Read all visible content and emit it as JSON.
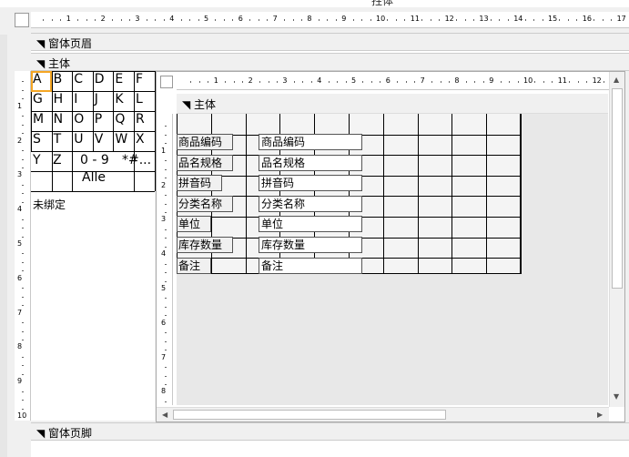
{
  "window": {
    "title": "拄体"
  },
  "sections": {
    "header_label": "窗体页眉",
    "detail_label": "主体",
    "footer_label": "窗体页脚"
  },
  "outer_ruler_h": [
    "1",
    "2",
    "3",
    "4",
    "5",
    "6",
    "7",
    "8",
    "9",
    "10",
    "11",
    "12",
    "13",
    "14",
    "15",
    "16",
    "17"
  ],
  "outer_ruler_v": [
    "1",
    "2",
    "3",
    "4",
    "5",
    "6",
    "7",
    "8",
    "9",
    "10"
  ],
  "az_letters": {
    "row1": [
      "A",
      "B",
      "C",
      "D",
      "E",
      "F"
    ],
    "row2": [
      "G",
      "H",
      "I",
      "J",
      "K",
      "L"
    ],
    "row3": [
      "M",
      "N",
      "O",
      "P",
      "Q",
      "R"
    ],
    "row4": [
      "S",
      "T",
      "U",
      "V",
      "W",
      "X"
    ],
    "row5": [
      "Y",
      "Z",
      "0 - 9",
      "*#..."
    ],
    "row6": [
      "Alle"
    ]
  },
  "unbound_label": "未绑定",
  "subform": {
    "section_label": "主体",
    "ruler_h": [
      "1",
      "2",
      "3",
      "4",
      "5",
      "6",
      "7",
      "8",
      "9",
      "10",
      "11",
      "12"
    ],
    "ruler_v": [
      "1",
      "2",
      "3",
      "4",
      "5",
      "6",
      "7",
      "8"
    ],
    "fields": [
      {
        "label": "商品编码",
        "value": "商品编码"
      },
      {
        "label": "品名规格",
        "value": "品名规格"
      },
      {
        "label": "拼音码",
        "value": "拼音码"
      },
      {
        "label": "分类名称",
        "value": "分类名称"
      },
      {
        "label": "单位",
        "value": "单位"
      },
      {
        "label": "库存数量",
        "value": "库存数量"
      },
      {
        "label": "备注",
        "value": "备注"
      }
    ]
  },
  "colors": {
    "selection": "#f5a623",
    "background": "#f0f0f0",
    "canvas": "#ffffff"
  }
}
